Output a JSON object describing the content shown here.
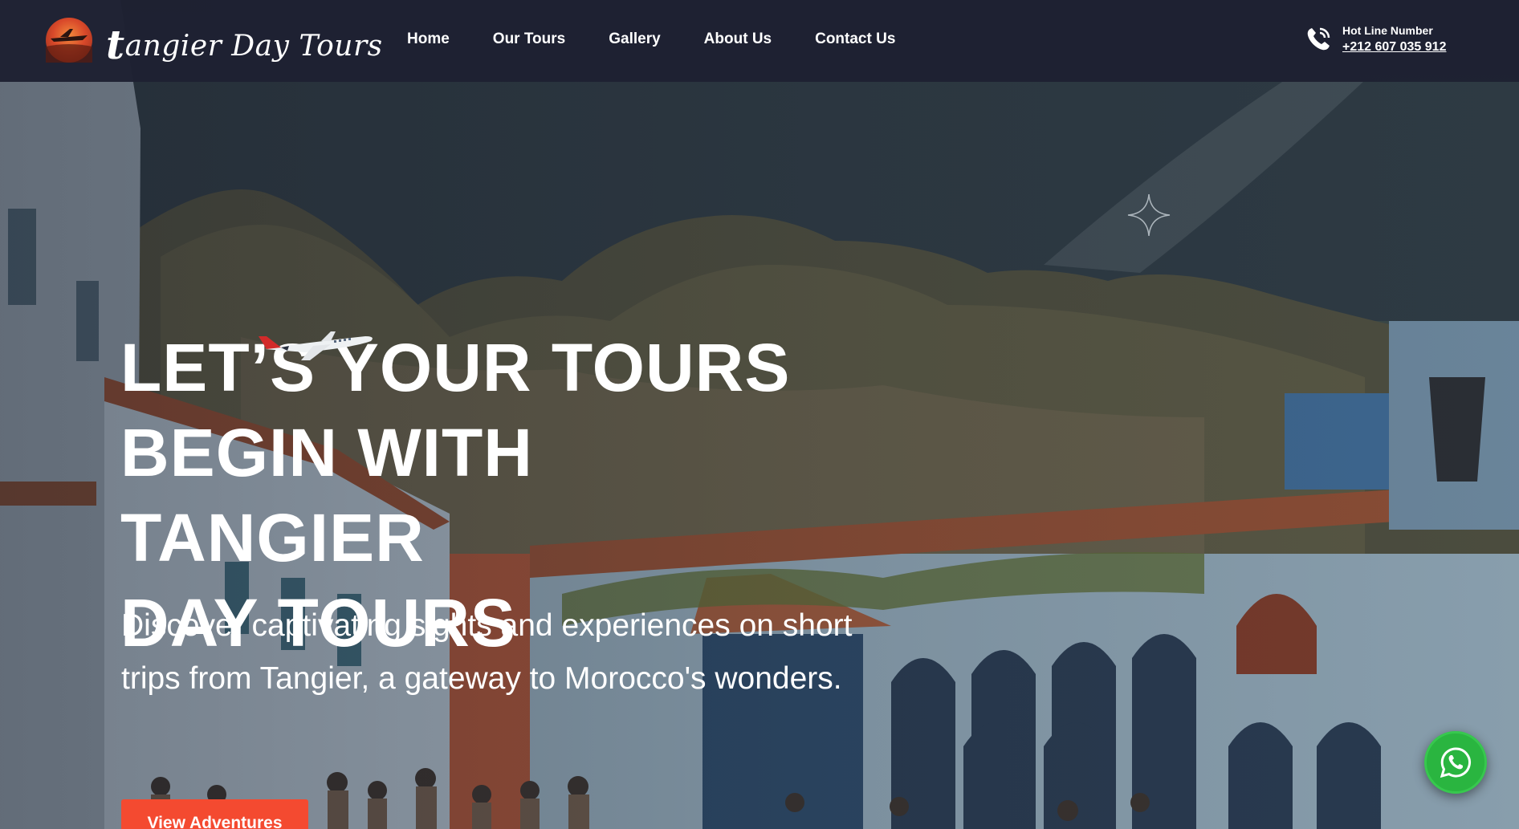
{
  "brand": {
    "initial": "t",
    "name": "angier Day Tours"
  },
  "nav": {
    "items": [
      {
        "label": "Home"
      },
      {
        "label": "Our Tours"
      },
      {
        "label": "Gallery"
      },
      {
        "label": "About Us"
      },
      {
        "label": "Contact Us"
      }
    ]
  },
  "hotline": {
    "label": "Hot Line Number",
    "number": "+212 607 035 912",
    "icon": "phone-icon"
  },
  "hero": {
    "headline_line1": "LET’S YOUR TOURS",
    "headline_line2": "BEGIN WITH TANGIER",
    "headline_line3": "DAY TOURS",
    "subtitle": "Discover captivating sights and experiences on short trips from Tangier, a gateway to Morocco's wonders.",
    "cta_label": "View Adventures"
  },
  "colors": {
    "header_bg": "#1e2132",
    "cta": "#f44a30",
    "whatsapp": "#2ab540"
  },
  "icons": {
    "whatsapp": "whatsapp-icon",
    "sparkle": "sparkle-icon",
    "airplane": "airplane-icon",
    "logo": "logo-badge"
  }
}
